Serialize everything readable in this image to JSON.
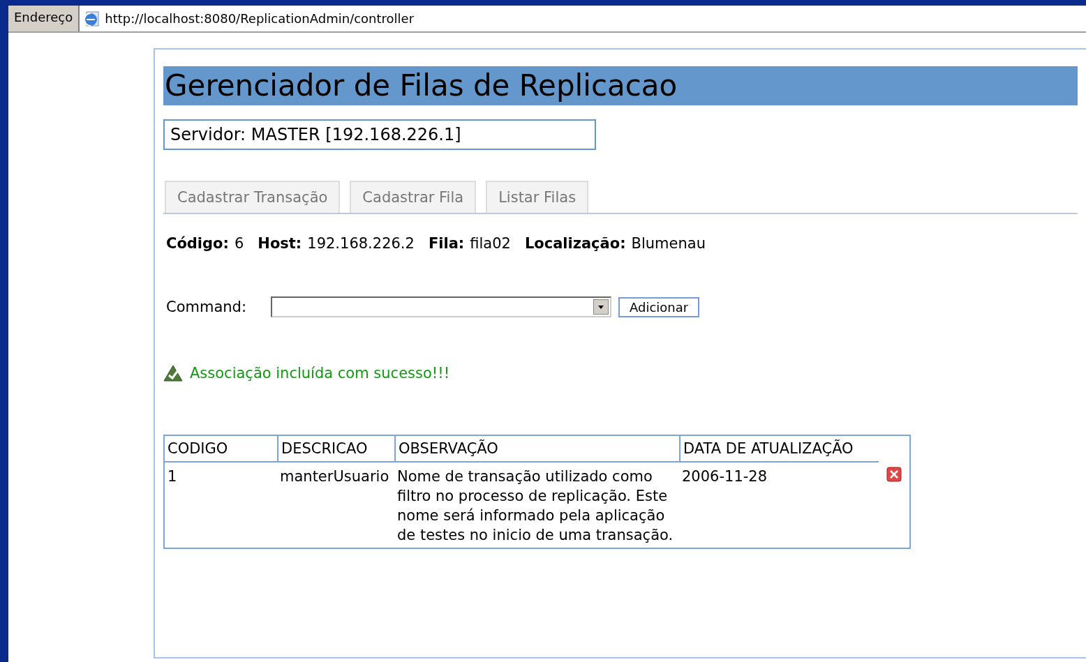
{
  "address_bar": {
    "label": "Endereço",
    "url": "http://localhost:8080/ReplicationAdmin/controller"
  },
  "title": "Gerenciador de Filas de Replicacao",
  "server": "Servidor: MASTER [192.168.226.1]",
  "tabs": [
    {
      "label": "Cadastrar Transação",
      "selected": false
    },
    {
      "label": "Cadastrar Fila",
      "selected": false
    },
    {
      "label": "Listar Filas",
      "selected": false
    }
  ],
  "info": [
    {
      "label": "Código:",
      "value": "6"
    },
    {
      "label": "Host:",
      "value": "192.168.226.2"
    },
    {
      "label": "Fila:",
      "value": "fila02"
    },
    {
      "label": "Localização:",
      "value": "Blumenau"
    }
  ],
  "command": {
    "label": "Command:",
    "button": "Adicionar"
  },
  "message": "Associação incluída com sucesso!!!",
  "table": {
    "columns": [
      "CODIGO",
      "DESCRICAO",
      "OBSERVAÇÃO",
      "DATA DE ATUALIZAÇÃO"
    ],
    "rows": [
      {
        "cells": [
          "1",
          "manterUsuario",
          "Nome de transação utilizado como filtro no processo de replicação. Este nome será informado pela aplicação de testes no inicio de uma transação.",
          "2006-11-28"
        ]
      }
    ]
  }
}
